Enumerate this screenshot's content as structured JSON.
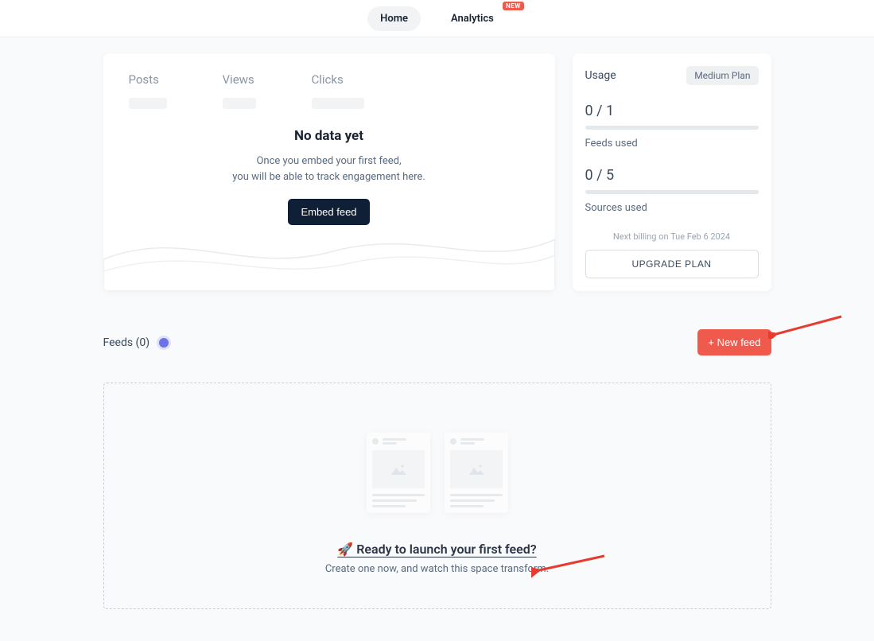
{
  "nav": {
    "home": "Home",
    "analytics": "Analytics",
    "new_badge": "NEW"
  },
  "engagement": {
    "stats": {
      "posts": "Posts",
      "views": "Views",
      "clicks": "Clicks"
    },
    "no_data_title": "No data yet",
    "no_data_line1": "Once you embed your first feed,",
    "no_data_line2": "you will be able to track engagement here.",
    "embed_btn": "Embed feed"
  },
  "usage": {
    "title": "Usage",
    "plan": "Medium Plan",
    "feeds_value": "0 / 1",
    "feeds_label": "Feeds used",
    "sources_value": "0 / 5",
    "sources_label": "Sources used",
    "billing": "Next billing on Tue Feb 6 2024",
    "upgrade": "UPGRADE PLAN"
  },
  "feeds": {
    "header": "Feeds (0)",
    "new_btn": "+ New feed",
    "launch_title": "🚀 Ready to launch your first feed?",
    "launch_sub": "Create one now, and watch this space transform."
  }
}
